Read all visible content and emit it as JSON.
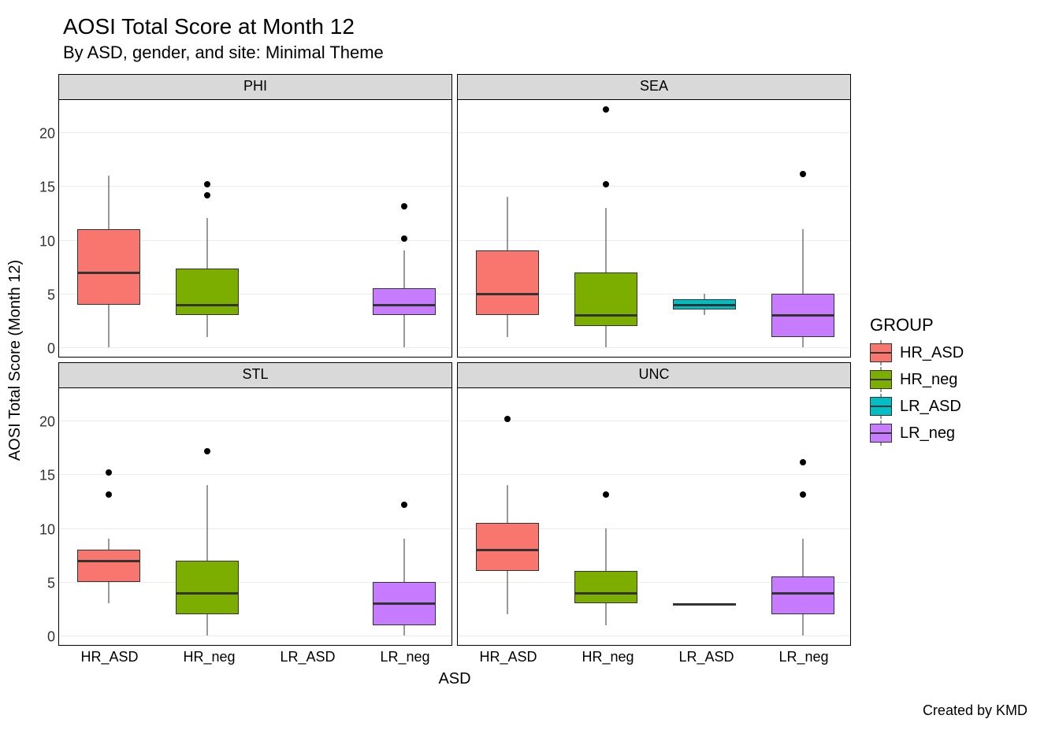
{
  "title": "AOSI Total Score at Month 12",
  "subtitle": "By ASD, gender, and site: Minimal Theme",
  "ylabel": "AOSI Total Score (Month 12)",
  "xlabel": "ASD",
  "caption": "Created by KMD",
  "legend_title": "GROUP",
  "y_ticks": [
    0,
    5,
    10,
    15,
    20
  ],
  "y_range": [
    -1,
    23
  ],
  "categories": [
    "HR_ASD",
    "HR_neg",
    "LR_ASD",
    "LR_neg"
  ],
  "colors": {
    "HR_ASD": "#F8766D",
    "HR_neg": "#7CAE00",
    "LR_ASD": "#00BFC4",
    "LR_neg": "#C77CFF"
  },
  "facets": [
    "PHI",
    "SEA",
    "STL",
    "UNC"
  ],
  "chart_data": {
    "type": "boxplot-facet-grid",
    "ylabel": "AOSI Total Score (Month 12)",
    "xlabel": "ASD",
    "title": "AOSI Total Score at Month 12",
    "subtitle": "By ASD, gender, and site: Minimal Theme",
    "legend": [
      "HR_ASD",
      "HR_neg",
      "LR_ASD",
      "LR_neg"
    ],
    "ylim": [
      -1,
      23
    ],
    "panels": {
      "PHI": {
        "HR_ASD": {
          "min": 0,
          "q1": 4,
          "median": 7,
          "q3": 11,
          "max": 16,
          "outliers": []
        },
        "HR_neg": {
          "min": 1,
          "q1": 3,
          "median": 4,
          "q3": 7.3,
          "max": 12,
          "outliers": [
            14,
            15
          ]
        },
        "LR_ASD": null,
        "LR_neg": {
          "min": 0,
          "q1": 3,
          "median": 4,
          "q3": 5.5,
          "max": 9,
          "outliers": [
            10,
            13
          ]
        }
      },
      "SEA": {
        "HR_ASD": {
          "min": 1,
          "q1": 3,
          "median": 5,
          "q3": 9,
          "max": 14,
          "outliers": []
        },
        "HR_neg": {
          "min": 0,
          "q1": 2,
          "median": 3,
          "q3": 7,
          "max": 13,
          "outliers": [
            15,
            22
          ]
        },
        "LR_ASD": {
          "min": 3,
          "q1": 3.5,
          "median": 4,
          "q3": 4.5,
          "max": 5,
          "outliers": []
        },
        "LR_neg": {
          "min": 0,
          "q1": 1,
          "median": 3,
          "q3": 5,
          "max": 11,
          "outliers": [
            16
          ]
        }
      },
      "STL": {
        "HR_ASD": {
          "min": 3,
          "q1": 5,
          "median": 7,
          "q3": 8,
          "max": 9,
          "outliers": [
            13,
            15
          ]
        },
        "HR_neg": {
          "min": 0,
          "q1": 2,
          "median": 4,
          "q3": 7,
          "max": 14,
          "outliers": [
            17
          ]
        },
        "LR_ASD": null,
        "LR_neg": {
          "min": 0,
          "q1": 1,
          "median": 3,
          "q3": 5,
          "max": 9,
          "outliers": [
            12
          ]
        }
      },
      "UNC": {
        "HR_ASD": {
          "min": 2,
          "q1": 6,
          "median": 8,
          "q3": 10.5,
          "max": 14,
          "outliers": [
            20
          ]
        },
        "HR_neg": {
          "min": 1,
          "q1": 3,
          "median": 4,
          "q3": 6,
          "max": 10,
          "outliers": [
            13
          ]
        },
        "LR_ASD": {
          "min": 3,
          "q1": 3,
          "median": 3,
          "q3": 3,
          "max": 3,
          "outliers": []
        },
        "LR_neg": {
          "min": 0,
          "q1": 2,
          "median": 4,
          "q3": 5.5,
          "max": 9,
          "outliers": [
            13,
            16
          ]
        }
      }
    }
  }
}
